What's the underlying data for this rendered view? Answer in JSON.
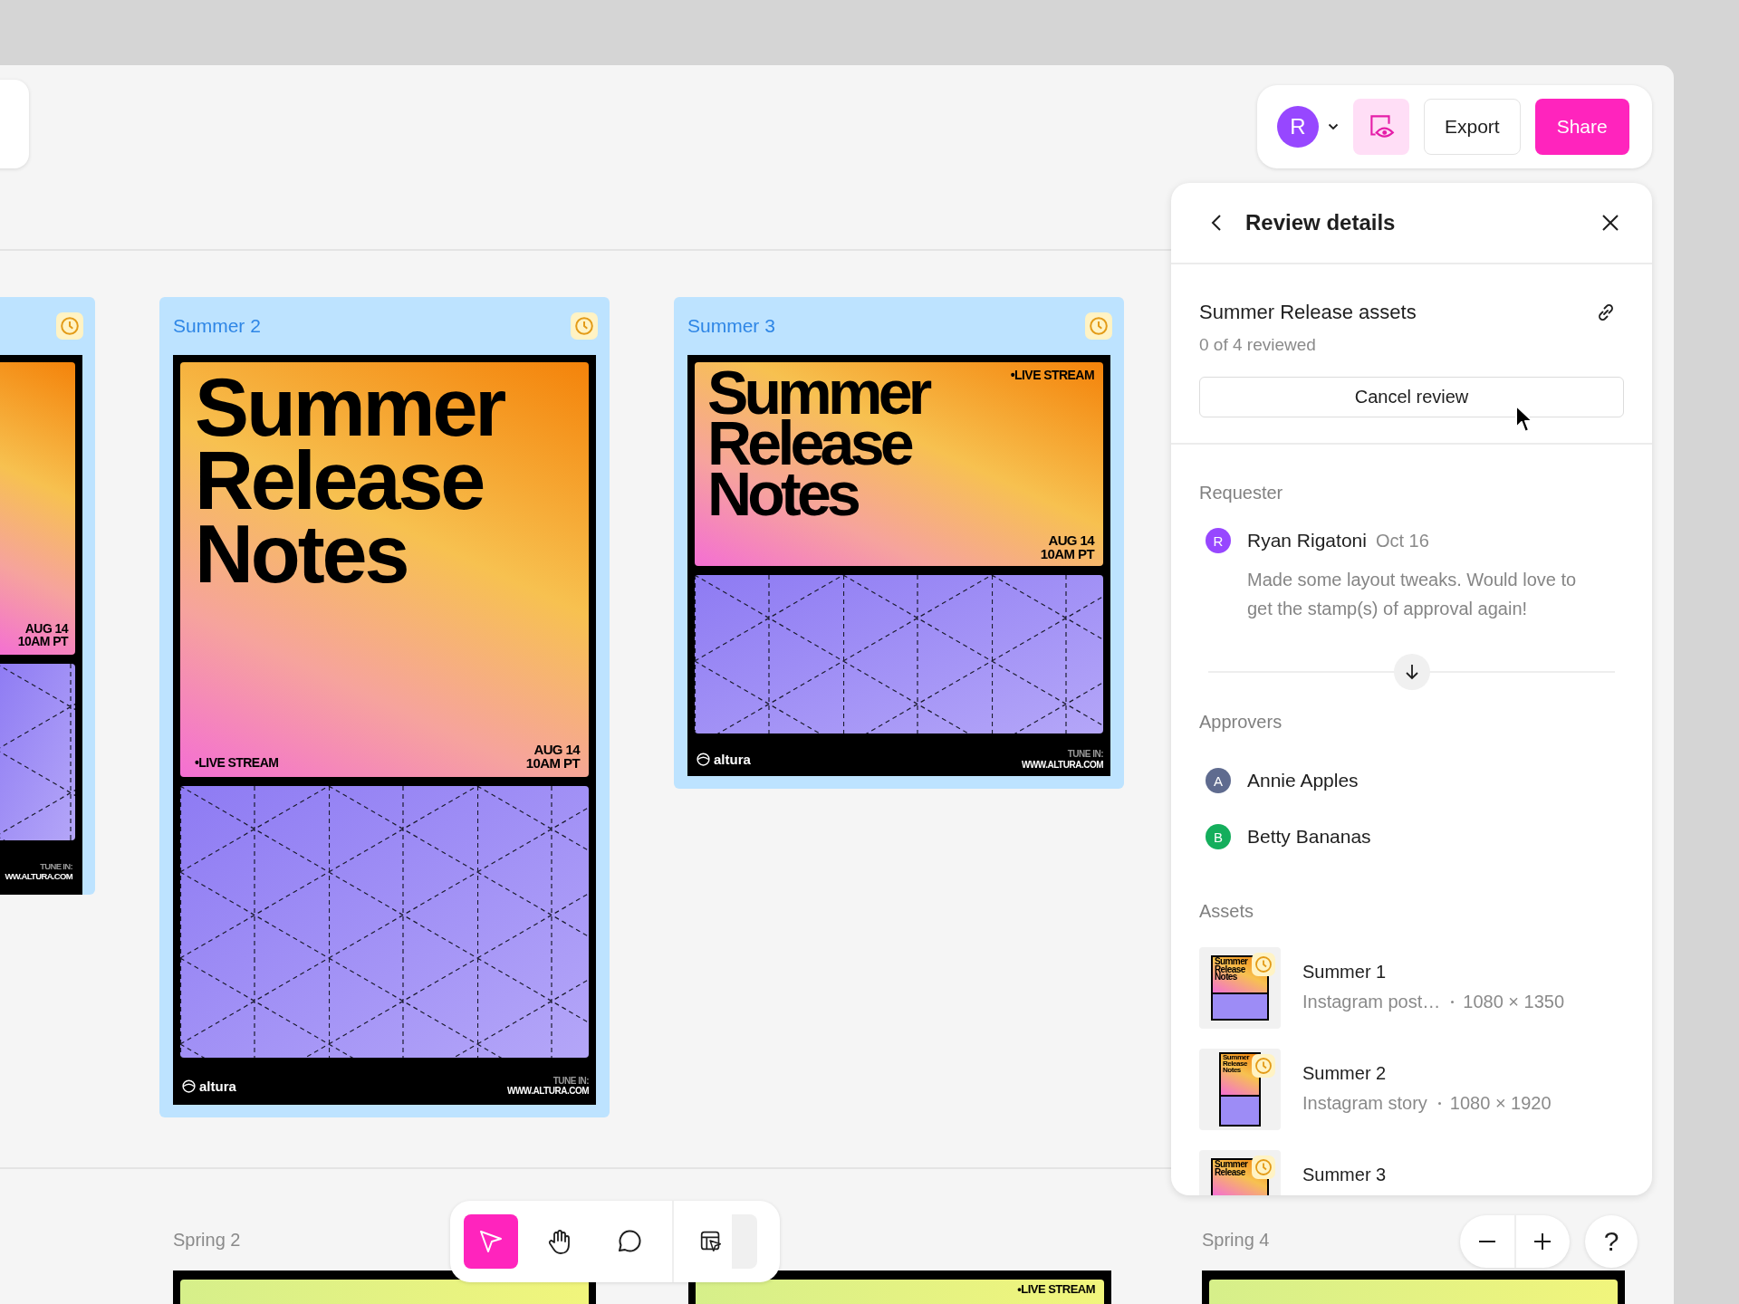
{
  "toolbar": {
    "avatar": "R",
    "review_view": {
      "selected": true
    },
    "buttons": [
      {
        "label": "Export",
        "kind": "secondary"
      },
      {
        "label": "Share",
        "kind": "primary"
      }
    ]
  },
  "frames": [
    {
      "kind": "partial",
      "poster": {
        "date": "AUG 14",
        "time": "10AM PT",
        "tune_in": "TUNE IN:",
        "url": "WW.ALTURA.COM"
      }
    },
    {
      "kind": "story",
      "title": "Summer 2",
      "poster": {
        "headline": "Summer Release Notes",
        "badge": "•LIVE STREAM",
        "date": "AUG 14",
        "time": "10AM PT",
        "logo": "altura",
        "tune_in": "TUNE IN:",
        "url": "WWW.ALTURA.COM"
      }
    },
    {
      "kind": "post",
      "title": "Summer 3",
      "poster": {
        "headline": "Summer Release Notes",
        "badge": "•LIVE STREAM",
        "date": "AUG 14",
        "time": "10AM PT",
        "logo": "altura",
        "tune_in": "TUNE IN:",
        "url": "WWW.ALTURA.COM"
      }
    }
  ],
  "sections": [
    {
      "title": "Spring 2"
    },
    {
      "title": "Spring 4"
    }
  ],
  "spring_posters": [
    {
      "kind": "plain"
    },
    {
      "kind": "badge",
      "badge": "•LIVE STREAM"
    },
    {
      "kind": "plain"
    }
  ],
  "review_panel": {
    "title": "Review details",
    "review_name": "Summer Release assets",
    "progress": "0 of 4 reviewed",
    "cancel_button": "Cancel review",
    "requester": {
      "heading": "Requester",
      "initial": "R",
      "name": "Ryan Rigatoni",
      "date": "Oct 16",
      "message": "Made some layout tweaks. Would love to get the stamp(s) of approval again!"
    },
    "approvers": {
      "heading": "Approvers",
      "people": [
        {
          "initial": "A",
          "name": "Annie Apples",
          "color": "#5f6b8f"
        },
        {
          "initial": "B",
          "name": "Betty Bananas",
          "color": "#14ae5c"
        }
      ]
    },
    "assets": {
      "heading": "Assets",
      "items": [
        {
          "kind": "post",
          "thumb_text": "Summer Release Notes",
          "name": "Summer 1",
          "type": "Instagram post…",
          "size": "1080 × 1350"
        },
        {
          "kind": "story",
          "thumb_text": "Summer Release Notes",
          "name": "Summer 2",
          "type": "Instagram story",
          "size": "1080 × 1920"
        },
        {
          "kind": "post",
          "thumb_text": "Summer Release",
          "name": "Summer 3"
        }
      ]
    }
  },
  "tools": [
    {
      "kind": "move",
      "selected": true
    },
    {
      "kind": "hand",
      "selected": false
    },
    {
      "kind": "comment",
      "selected": false
    },
    {
      "kind": "actions",
      "selected": false
    }
  ],
  "help": "?"
}
